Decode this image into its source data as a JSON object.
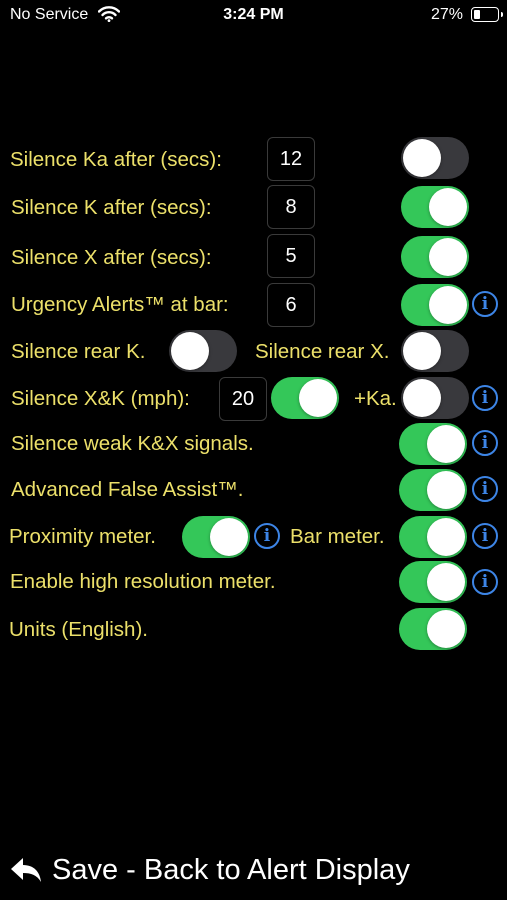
{
  "status_bar": {
    "carrier": "No Service",
    "time": "3:24 PM",
    "battery_percent": "27%",
    "battery_level": 0.27
  },
  "settings": {
    "silence_ka": {
      "label": "Silence Ka after (secs):",
      "value": "12",
      "enabled": false
    },
    "silence_k": {
      "label": "Silence K after (secs):",
      "value": "8",
      "enabled": true
    },
    "silence_x": {
      "label": "Silence X after (secs):",
      "value": "5",
      "enabled": true
    },
    "urgency_alerts": {
      "label": "Urgency Alerts™ at bar:",
      "value": "6",
      "enabled": true
    },
    "silence_rear_k": {
      "label": "Silence rear K.",
      "enabled": false
    },
    "silence_rear_x": {
      "label": "Silence rear X.",
      "enabled": false
    },
    "silence_xk_mph": {
      "label": "Silence X&K (mph):",
      "value": "20",
      "enabled": true
    },
    "plus_ka": {
      "label": "+Ka.",
      "enabled": false
    },
    "silence_weak": {
      "label": "Silence weak K&X signals.",
      "enabled": true
    },
    "advanced_false_assist": {
      "label": "Advanced False Assist™.",
      "enabled": true
    },
    "proximity_meter": {
      "label": "Proximity meter.",
      "enabled": true
    },
    "bar_meter": {
      "label": "Bar meter.",
      "enabled": true
    },
    "high_res_meter": {
      "label": "Enable high resolution meter.",
      "enabled": true
    },
    "units": {
      "label": "Units (English).",
      "enabled": true
    }
  },
  "info_glyph": "i",
  "footer": {
    "save_label": "Save - Back to Alert Display"
  },
  "colors": {
    "label": "#ece06a",
    "toggle_on": "#34c759",
    "toggle_off": "#39393d",
    "info": "#3d85e6"
  }
}
